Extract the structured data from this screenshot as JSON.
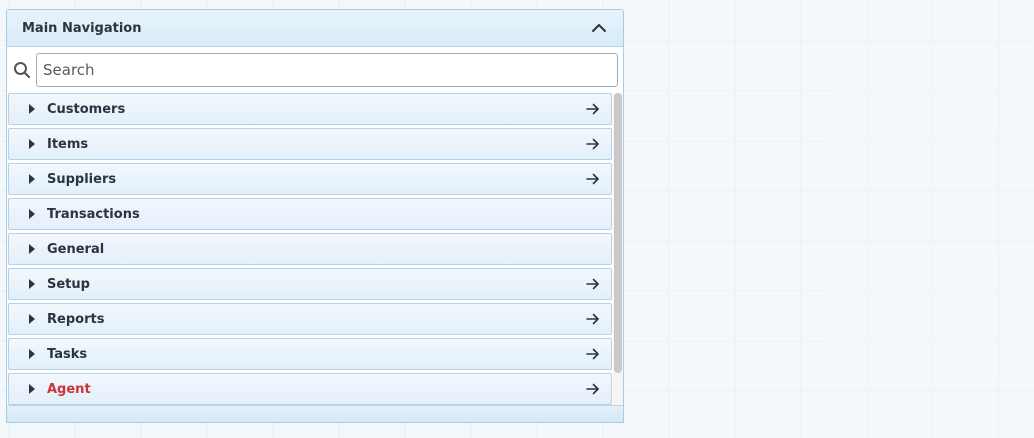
{
  "panel": {
    "title": "Main Navigation",
    "collapse_icon": "chevron-up-icon"
  },
  "search": {
    "placeholder": "Search",
    "value": "",
    "icon": "search-icon"
  },
  "nav": {
    "items": [
      {
        "label": "Customers",
        "has_arrow": true,
        "highlight": false
      },
      {
        "label": "Items",
        "has_arrow": true,
        "highlight": false
      },
      {
        "label": "Suppliers",
        "has_arrow": true,
        "highlight": false
      },
      {
        "label": "Transactions",
        "has_arrow": false,
        "highlight": false
      },
      {
        "label": "General",
        "has_arrow": false,
        "highlight": false
      },
      {
        "label": "Setup",
        "has_arrow": true,
        "highlight": false
      },
      {
        "label": "Reports",
        "has_arrow": true,
        "highlight": false
      },
      {
        "label": "Tasks",
        "has_arrow": true,
        "highlight": false
      },
      {
        "label": "Agent",
        "has_arrow": true,
        "highlight": true
      }
    ]
  },
  "colors": {
    "label": "#2b3440",
    "highlight": "#d0323a",
    "border": "#a9cbe3"
  }
}
